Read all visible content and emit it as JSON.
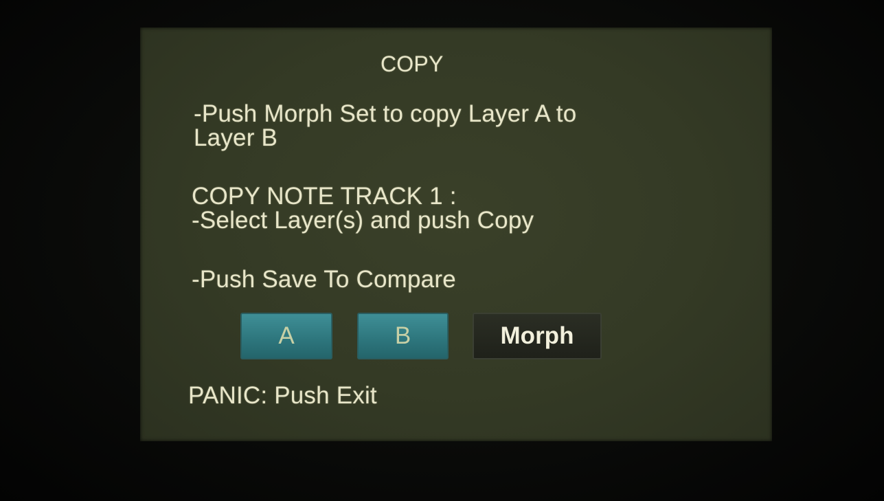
{
  "screen": {
    "title": "COPY",
    "lines": [
      "-Push Morph Set to copy Layer A to",
      "Layer B",
      "COPY NOTE TRACK  1   :",
      "-Select Layer(s) and push Copy",
      "-Push Save To Compare"
    ],
    "buttons": {
      "a": "A",
      "b": "B",
      "morph": "Morph"
    },
    "panic": "PANIC: Push Exit"
  },
  "colors": {
    "screen_background": "#343a25",
    "text": "#e8e6c9",
    "selected_button": "#2d757c",
    "unselected_button": "#1f211a"
  }
}
